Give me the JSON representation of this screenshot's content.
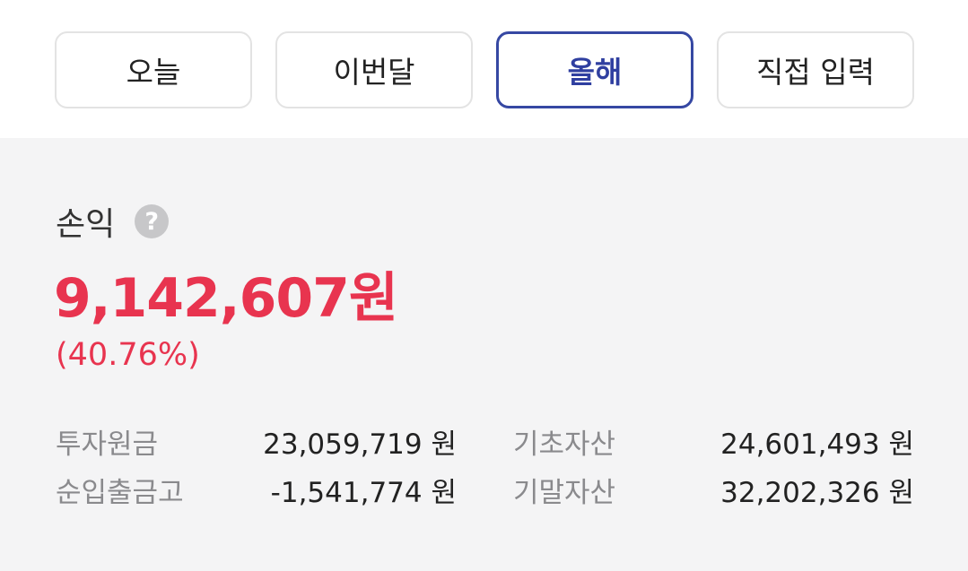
{
  "period_tabs": [
    {
      "label": "오늘",
      "active": false
    },
    {
      "label": "이번달",
      "active": false
    },
    {
      "label": "올해",
      "active": true
    },
    {
      "label": "직접 입력",
      "active": false
    }
  ],
  "summary": {
    "label": "손익",
    "help_icon": "?",
    "amount": "9,142,607원",
    "rate": "(40.76%)"
  },
  "stats": {
    "principal_label": "투자원금",
    "principal_value": "23,059,719 원",
    "net_flow_label": "순입출금고",
    "net_flow_value": "-1,541,774 원",
    "start_assets_label": "기초자산",
    "start_assets_value": "24,601,493 원",
    "end_assets_label": "기말자산",
    "end_assets_value": "32,202,326 원"
  },
  "colors": {
    "accent": "#2f3fa0",
    "profit": "#e8344f",
    "panel_bg": "#f4f4f5"
  }
}
